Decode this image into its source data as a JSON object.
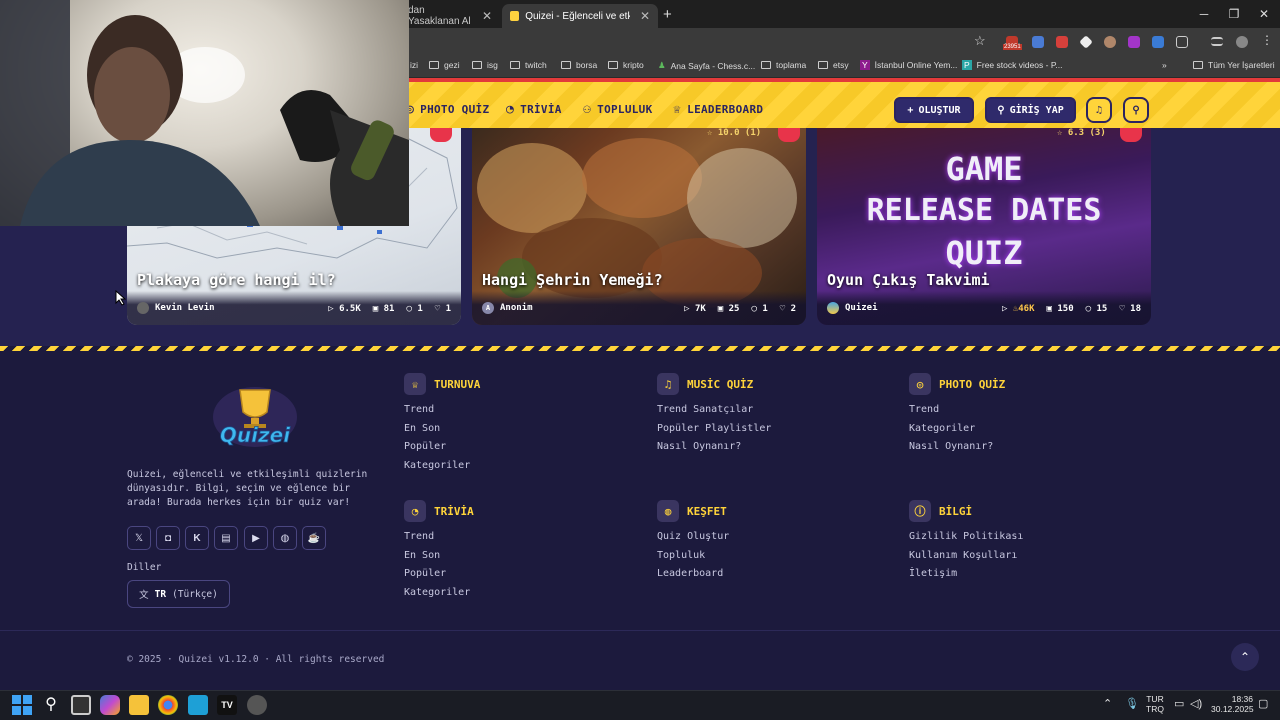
{
  "browser": {
    "tabs": [
      {
        "title": "dan Yasaklanan Al",
        "active": false
      },
      {
        "title": "Quizei - Eğlenceli ve etkileşimli",
        "active": true
      }
    ],
    "bookmarks": [
      "izi",
      "gezi",
      "isg",
      "twitch",
      "borsa",
      "kripto",
      "Ana Sayfa - Chess.c...",
      "toplama",
      "etsy",
      "İstanbul Online Yem...",
      "Free stock videos - P..."
    ],
    "all_bookmarks": "Tüm Yer İşaretleri",
    "ext_badge": "23951"
  },
  "nav": {
    "photo_quiz": "PHOTO QUİZ",
    "trivia": "TRİVİA",
    "community": "TOPLULUK",
    "leaderboard": "LEADERBOARD",
    "create": "OLUŞTUR",
    "login": "GİRİŞ YAP"
  },
  "cards": [
    {
      "title": "Plakaya göre hangi il?",
      "author": "Kevin Levin",
      "plays": "6.5K",
      "images": "81",
      "comments": "1",
      "likes": "1"
    },
    {
      "title": "Hangi Şehrin Yemeği?",
      "author": "Anonim",
      "author_initial": "A",
      "plays": "7K",
      "images": "25",
      "comments": "1",
      "likes": "2",
      "rating": "10.0 (1)"
    },
    {
      "title": "Oyun Çıkış Takvimi",
      "author": "Quizei",
      "plays": "46K",
      "images": "150",
      "comments": "15",
      "likes": "18",
      "rating": "6.3 (3)",
      "image_text": [
        "GAME",
        "RELEASE DATES",
        "QUIZ"
      ]
    }
  ],
  "footer": {
    "logo_text": "Quizei",
    "about": "Quizei, eğlenceli ve etkileşimli quizlerin dünyasıdır. Bilgi, seçim ve eğlence bir arada! Burada herkes için bir quiz var!",
    "languages_label": "Diller",
    "lang_code": "TR",
    "lang_name": "(Türkçe)",
    "columns": [
      {
        "title": "TURNUVA",
        "links": [
          "Trend",
          "En Son",
          "Popüler",
          "Kategoriler"
        ]
      },
      {
        "title": "MUSİC QUİZ",
        "links": [
          "Trend Sanatçılar",
          "Popüler Playlistler",
          "Nasıl Oynanır?"
        ]
      },
      {
        "title": "PHOTO QUİZ",
        "links": [
          "Trend",
          "Kategoriler",
          "Nasıl Oynanır?"
        ]
      },
      {
        "title": "TRİVİA",
        "links": [
          "Trend",
          "En Son",
          "Popüler",
          "Kategoriler"
        ]
      },
      {
        "title": "KEŞFET",
        "links": [
          "Quiz Oluştur",
          "Topluluk",
          "Leaderboard"
        ]
      },
      {
        "title": "BİLGİ",
        "links": [
          "Gizlilik Politikası",
          "Kullanım Koşulları",
          "İletişim"
        ]
      }
    ],
    "copyright": "© 2025 · Quizei v1.12.0 · All rights reserved"
  },
  "taskbar": {
    "lang_top": "TUR",
    "lang_bottom": "TRQ",
    "time": "18:36",
    "date": "30.12.2025"
  },
  "colors": {
    "accent_yellow": "#ffd43a",
    "page_bg": "#1c1a3d",
    "brand_navy": "#2f2a6b",
    "cart_red": "#e8344a"
  }
}
